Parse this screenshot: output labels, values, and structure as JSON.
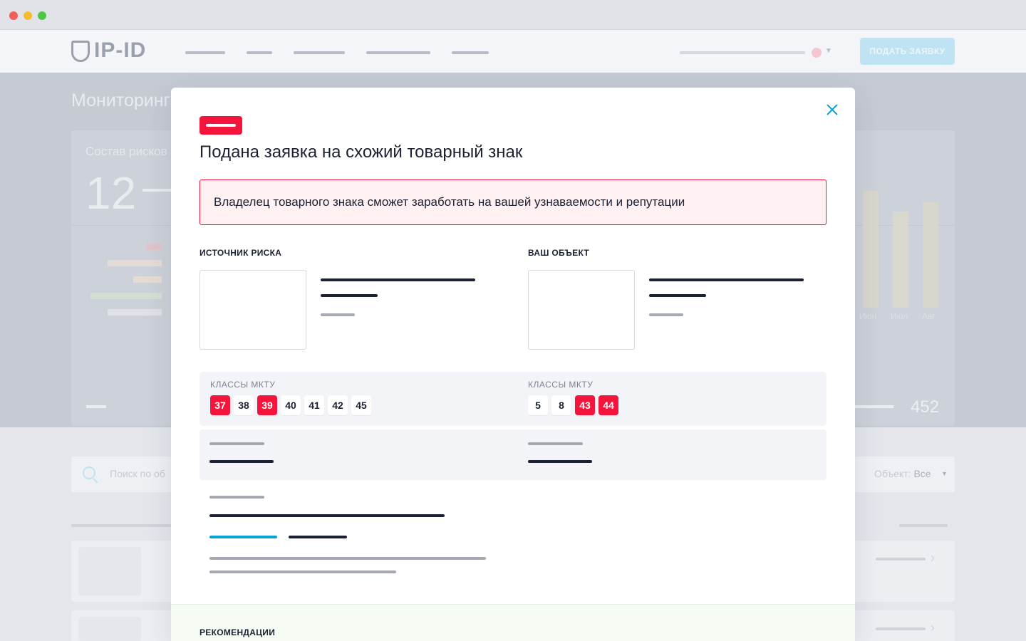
{
  "app": {
    "logo_text": "IP-ID",
    "submit_button": "ПОДАТЬ ЗАЯВКУ",
    "page_title": "Мониторинг",
    "risk_card_title": "Состав рисков",
    "risk_count": "12",
    "months": [
      "Июн",
      "Июл",
      "Авг"
    ],
    "stat_value": "452",
    "search_placeholder": "Поиск по об",
    "filter_label": "Объект:",
    "filter_value": "Все"
  },
  "modal": {
    "title": "Подана заявка на схожий товарный знак",
    "alert_text": "Владелец товарного знака сможет заработать на вашей узнаваемости и репутации",
    "left_column_label": "ИСТОЧНИК РИСКА",
    "right_column_label": "ВАШ ОБЪЕКТ",
    "classes_label": "КЛАССЫ МКТУ",
    "source_classes": [
      {
        "num": "37",
        "match": true
      },
      {
        "num": "38",
        "match": false
      },
      {
        "num": "39",
        "match": true
      },
      {
        "num": "40",
        "match": false
      },
      {
        "num": "41",
        "match": false
      },
      {
        "num": "42",
        "match": false
      },
      {
        "num": "45",
        "match": false
      }
    ],
    "object_classes": [
      {
        "num": "5",
        "match": false
      },
      {
        "num": "8",
        "match": false
      },
      {
        "num": "43",
        "match": true
      },
      {
        "num": "44",
        "match": true
      }
    ],
    "recommendations_label": "РЕКОМЕНДАЦИИ"
  },
  "colors": {
    "accent": "#0aa3d8",
    "danger": "#f5143c",
    "alert_bg": "#fff0f2",
    "text": "#1a2133"
  },
  "icons": {
    "close": "close-icon",
    "logo": "shield-logo-icon",
    "search": "search-icon"
  }
}
